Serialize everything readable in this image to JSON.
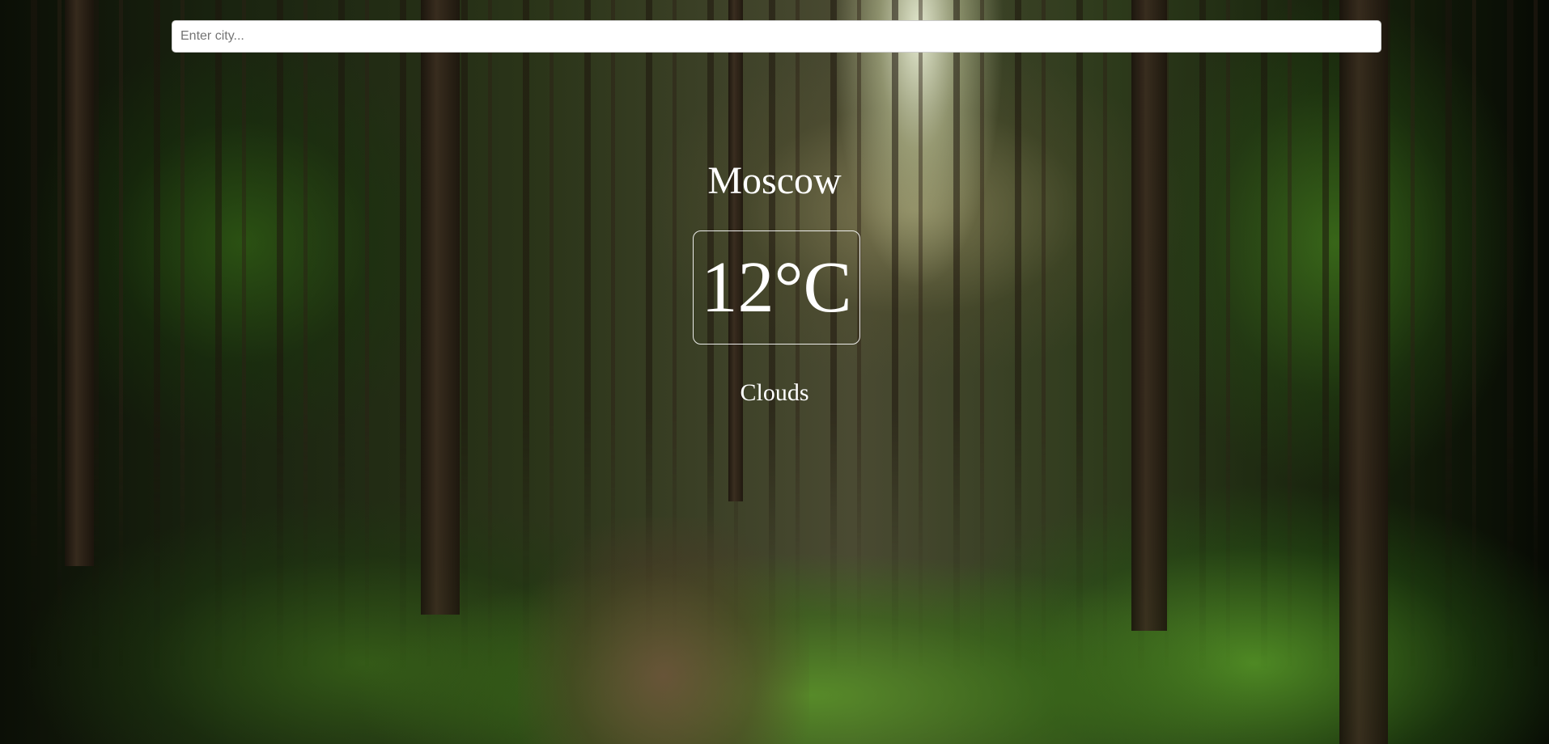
{
  "search": {
    "placeholder": "Enter city...",
    "value": ""
  },
  "weather": {
    "city": "Moscow",
    "temperature": "12°C",
    "description": "Clouds"
  },
  "background": {
    "scene": "forest"
  }
}
